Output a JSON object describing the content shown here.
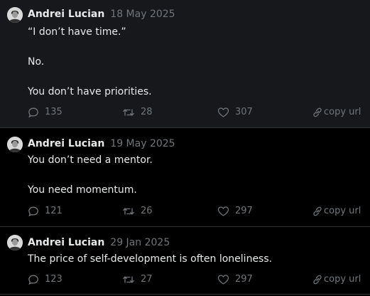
{
  "posts": [
    {
      "author": "Andrei Lucian",
      "date": "18 May 2025",
      "lines": [
        "“I don’t have time.”",
        "No.",
        "You don’t have priorities."
      ],
      "replies": "135",
      "reposts": "28",
      "likes": "307",
      "copy_label": "copy url"
    },
    {
      "author": "Andrei Lucian",
      "date": "19 May 2025",
      "lines": [
        "You don’t need a mentor.",
        "You need momentum."
      ],
      "replies": "121",
      "reposts": "26",
      "likes": "297",
      "copy_label": "copy url"
    },
    {
      "author": "Andrei Lucian",
      "date": "29 Jan 2025",
      "lines": [
        "The price of self-development is often loneliness."
      ],
      "replies": "123",
      "reposts": "27",
      "likes": "297",
      "copy_label": "copy url"
    }
  ],
  "icons": {
    "avatar": "avatar-photo",
    "reply": "speech-bubble-icon",
    "repost": "repost-arrows-icon",
    "like": "heart-icon",
    "copy": "link-icon"
  },
  "colors": {
    "background": "#000000",
    "highlighted_post": "#16181c",
    "text": "#e7e9ea",
    "muted": "#71767b",
    "divider": "#2f3336"
  }
}
